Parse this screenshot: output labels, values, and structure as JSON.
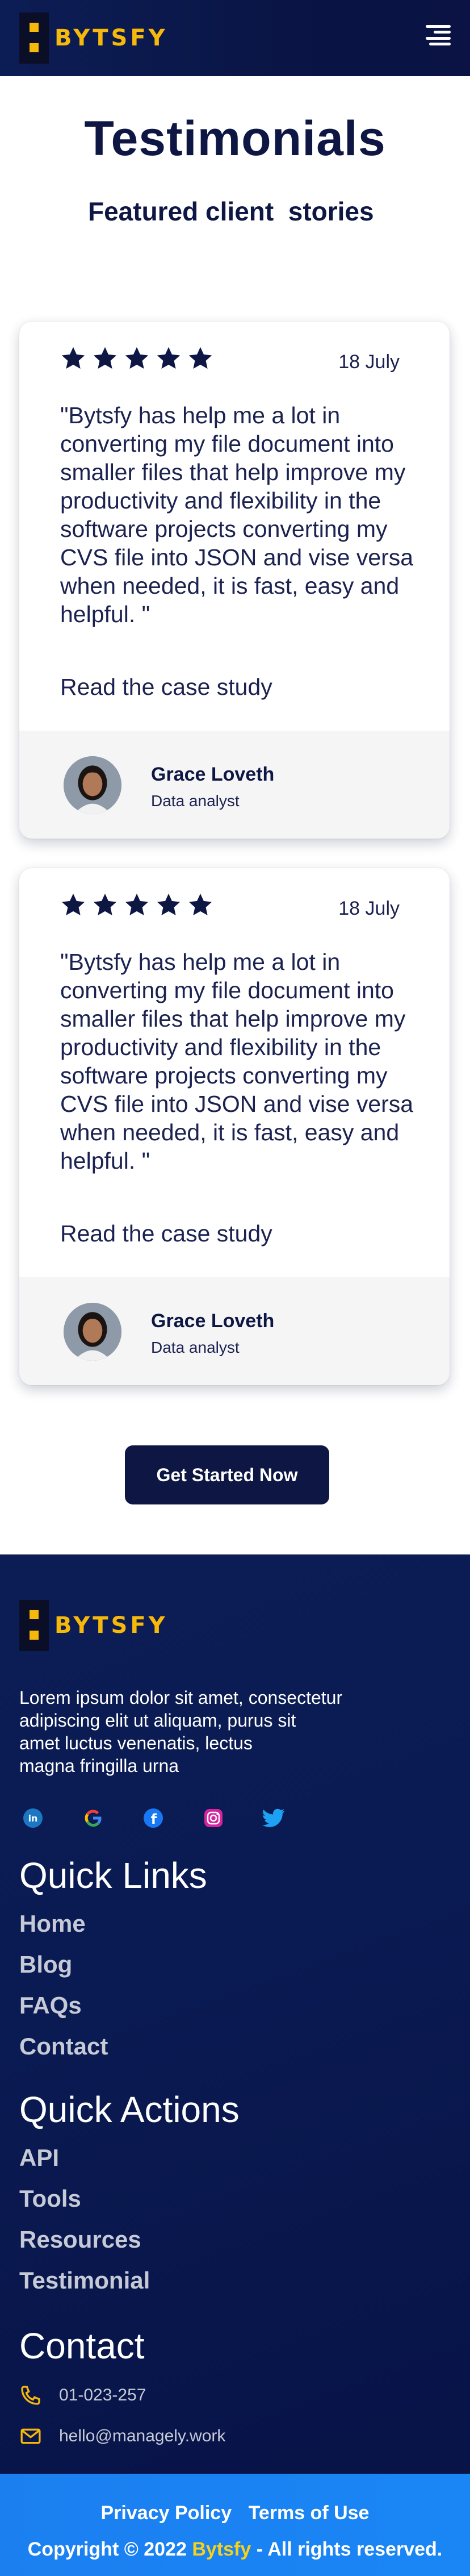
{
  "brand": {
    "name": "BYTSFY",
    "accent_color": "#f6b80a",
    "primary_color": "#0e1744"
  },
  "header": {
    "menu_icon": "hamburger-menu-icon"
  },
  "testimonials": {
    "title": "Testimonials",
    "subtitle": "Featured client  stories",
    "cards": [
      {
        "rating": 5,
        "date": "18 July",
        "quote": "\"Bytsfy has help me a lot in converting my file document into smaller files that help improve my productivity and flexibility in the software projects converting my CVS file into JSON and vise versa when needed, it is fast, easy and helpful. \"",
        "link_label": "Read the case study",
        "author_name": "Grace Loveth",
        "author_role": "Data analyst"
      },
      {
        "rating": 5,
        "date": "18 July",
        "quote": "\"Bytsfy has help me a lot in converting my file document into smaller files that help improve my productivity and flexibility in the software projects converting my CVS file into JSON and vise versa when needed, it is fast, easy and helpful. \"",
        "link_label": "Read the case study",
        "author_name": "Grace Loveth",
        "author_role": "Data analyst"
      }
    ]
  },
  "cta": {
    "label": "Get Started Now"
  },
  "footer": {
    "about": "Lorem ipsum dolor sit amet, consectetur\nadipiscing elit ut aliquam, purus sit\namet luctus venenatis, lectus\nmagna fringilla urna",
    "socials": [
      "linkedin-icon",
      "google-icon",
      "facebook-icon",
      "instagram-icon",
      "twitter-icon"
    ],
    "quick_links": {
      "heading": "Quick Links",
      "items": [
        "Home",
        "Blog",
        "FAQs",
        "Contact"
      ]
    },
    "quick_actions": {
      "heading": "Quick Actions",
      "items": [
        "API",
        "Tools",
        "Resources",
        "Testimonial"
      ]
    },
    "contact": {
      "heading": "Contact",
      "phone": "01-023-257",
      "email": "hello@managely.work"
    }
  },
  "bottom": {
    "privacy": "Privacy Policy",
    "terms": "Terms of Use",
    "copyright_prefix": "Copyright © 2022 ",
    "copyright_brand": "Bytsfy",
    "copyright_suffix": " - All rights reserved."
  }
}
